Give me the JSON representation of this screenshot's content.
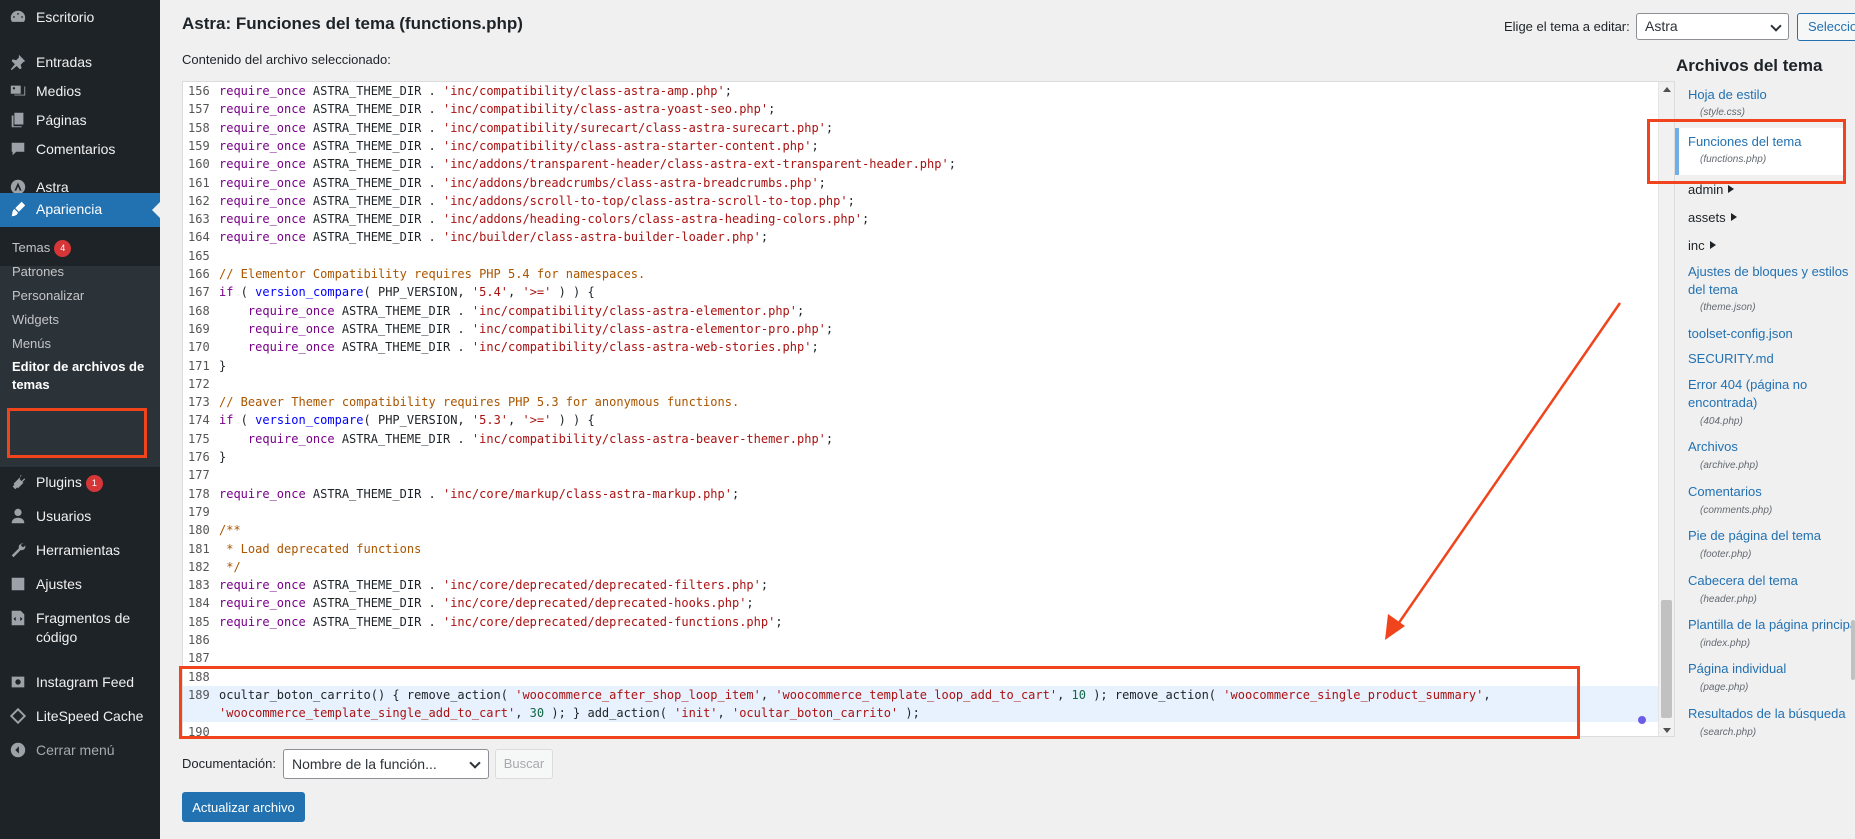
{
  "sidebar": {
    "items": [
      {
        "label": "Escritorio",
        "icon": "dashboard-icon"
      },
      {
        "label": "Entradas",
        "icon": "pin-icon"
      },
      {
        "label": "Medios",
        "icon": "media-icon"
      },
      {
        "label": "Páginas",
        "icon": "pages-icon"
      },
      {
        "label": "Comentarios",
        "icon": "comment-icon"
      },
      {
        "label": "Astra",
        "icon": "astra-icon"
      },
      {
        "label": "Apariencia",
        "icon": "brush-icon"
      },
      {
        "label": "Plugins",
        "icon": "plugin-icon",
        "badge": "1"
      },
      {
        "label": "Usuarios",
        "icon": "user-icon"
      },
      {
        "label": "Herramientas",
        "icon": "wrench-icon"
      },
      {
        "label": "Ajustes",
        "icon": "settings-icon"
      },
      {
        "label": "Fragmentos de código",
        "icon": "code-icon"
      },
      {
        "label": "Instagram Feed",
        "icon": "instagram-icon"
      },
      {
        "label": "LiteSpeed Cache",
        "icon": "diamond-icon"
      },
      {
        "label": "Cerrar menú",
        "icon": "collapse-icon"
      }
    ],
    "submenu": [
      {
        "label": "Temas",
        "badge": "4"
      },
      {
        "label": "Patrones"
      },
      {
        "label": "Personalizar"
      },
      {
        "label": "Widgets"
      },
      {
        "label": "Menús"
      },
      {
        "label": "Editor de archivos de temas"
      }
    ]
  },
  "header": {
    "title": "Astra: Funciones del tema (functions.php)",
    "theme_select_label": "Elige el tema a editar:",
    "theme_select_value": "Astra",
    "select_button": "Seleccionar",
    "content_label": "Contenido del archivo seleccionado:"
  },
  "editor": {
    "lines": [
      {
        "n": "156",
        "code": [
          [
            "kw",
            "require_once"
          ],
          [
            "vr",
            " ASTRA_THEME_DIR . "
          ],
          [
            "str",
            "'inc/compatibility/class-astra-amp.php'"
          ],
          [
            "vr",
            ";"
          ]
        ]
      },
      {
        "n": "157",
        "code": [
          [
            "kw",
            "require_once"
          ],
          [
            "vr",
            " ASTRA_THEME_DIR . "
          ],
          [
            "str",
            "'inc/compatibility/class-astra-yoast-seo.php'"
          ],
          [
            "vr",
            ";"
          ]
        ]
      },
      {
        "n": "158",
        "code": [
          [
            "kw",
            "require_once"
          ],
          [
            "vr",
            " ASTRA_THEME_DIR . "
          ],
          [
            "str",
            "'inc/compatibility/surecart/class-astra-surecart.php'"
          ],
          [
            "vr",
            ";"
          ]
        ]
      },
      {
        "n": "159",
        "code": [
          [
            "kw",
            "require_once"
          ],
          [
            "vr",
            " ASTRA_THEME_DIR . "
          ],
          [
            "str",
            "'inc/compatibility/class-astra-starter-content.php'"
          ],
          [
            "vr",
            ";"
          ]
        ]
      },
      {
        "n": "160",
        "code": [
          [
            "kw",
            "require_once"
          ],
          [
            "vr",
            " ASTRA_THEME_DIR . "
          ],
          [
            "str",
            "'inc/addons/transparent-header/class-astra-ext-transparent-header.php'"
          ],
          [
            "vr",
            ";"
          ]
        ]
      },
      {
        "n": "161",
        "code": [
          [
            "kw",
            "require_once"
          ],
          [
            "vr",
            " ASTRA_THEME_DIR . "
          ],
          [
            "str",
            "'inc/addons/breadcrumbs/class-astra-breadcrumbs.php'"
          ],
          [
            "vr",
            ";"
          ]
        ]
      },
      {
        "n": "162",
        "code": [
          [
            "kw",
            "require_once"
          ],
          [
            "vr",
            " ASTRA_THEME_DIR . "
          ],
          [
            "str",
            "'inc/addons/scroll-to-top/class-astra-scroll-to-top.php'"
          ],
          [
            "vr",
            ";"
          ]
        ]
      },
      {
        "n": "163",
        "code": [
          [
            "kw",
            "require_once"
          ],
          [
            "vr",
            " ASTRA_THEME_DIR . "
          ],
          [
            "str",
            "'inc/addons/heading-colors/class-astra-heading-colors.php'"
          ],
          [
            "vr",
            ";"
          ]
        ]
      },
      {
        "n": "164",
        "code": [
          [
            "kw",
            "require_once"
          ],
          [
            "vr",
            " ASTRA_THEME_DIR . "
          ],
          [
            "str",
            "'inc/builder/class-astra-builder-loader.php'"
          ],
          [
            "vr",
            ";"
          ]
        ]
      },
      {
        "n": "165",
        "code": []
      },
      {
        "n": "166",
        "code": [
          [
            "cm",
            "// Elementor Compatibility requires PHP 5.4 for namespaces."
          ]
        ]
      },
      {
        "n": "167",
        "code": [
          [
            "kw",
            "if"
          ],
          [
            "vr",
            " ( "
          ],
          [
            "df",
            "version_compare"
          ],
          [
            "vr",
            "( PHP_VERSION, "
          ],
          [
            "str",
            "'5.4'"
          ],
          [
            "vr",
            ", "
          ],
          [
            "str",
            "'>='"
          ],
          [
            "vr",
            " ) ) {"
          ]
        ]
      },
      {
        "n": "168",
        "code": [
          [
            "vr",
            "    "
          ],
          [
            "kw",
            "require_once"
          ],
          [
            "vr",
            " ASTRA_THEME_DIR . "
          ],
          [
            "str",
            "'inc/compatibility/class-astra-elementor.php'"
          ],
          [
            "vr",
            ";"
          ]
        ]
      },
      {
        "n": "169",
        "code": [
          [
            "vr",
            "    "
          ],
          [
            "kw",
            "require_once"
          ],
          [
            "vr",
            " ASTRA_THEME_DIR . "
          ],
          [
            "str",
            "'inc/compatibility/class-astra-elementor-pro.php'"
          ],
          [
            "vr",
            ";"
          ]
        ]
      },
      {
        "n": "170",
        "code": [
          [
            "vr",
            "    "
          ],
          [
            "kw",
            "require_once"
          ],
          [
            "vr",
            " ASTRA_THEME_DIR . "
          ],
          [
            "str",
            "'inc/compatibility/class-astra-web-stories.php'"
          ],
          [
            "vr",
            ";"
          ]
        ]
      },
      {
        "n": "171",
        "code": [
          [
            "vr",
            "}"
          ]
        ]
      },
      {
        "n": "172",
        "code": []
      },
      {
        "n": "173",
        "code": [
          [
            "cm",
            "// Beaver Themer compatibility requires PHP 5.3 for anonymous functions."
          ]
        ]
      },
      {
        "n": "174",
        "code": [
          [
            "kw",
            "if"
          ],
          [
            "vr",
            " ( "
          ],
          [
            "df",
            "version_compare"
          ],
          [
            "vr",
            "( PHP_VERSION, "
          ],
          [
            "str",
            "'5.3'"
          ],
          [
            "vr",
            ", "
          ],
          [
            "str",
            "'>='"
          ],
          [
            "vr",
            " ) ) {"
          ]
        ]
      },
      {
        "n": "175",
        "code": [
          [
            "vr",
            "    "
          ],
          [
            "kw",
            "require_once"
          ],
          [
            "vr",
            " ASTRA_THEME_DIR . "
          ],
          [
            "str",
            "'inc/compatibility/class-astra-beaver-themer.php'"
          ],
          [
            "vr",
            ";"
          ]
        ]
      },
      {
        "n": "176",
        "code": [
          [
            "vr",
            "}"
          ]
        ]
      },
      {
        "n": "177",
        "code": []
      },
      {
        "n": "178",
        "code": [
          [
            "kw",
            "require_once"
          ],
          [
            "vr",
            " ASTRA_THEME_DIR . "
          ],
          [
            "str",
            "'inc/core/markup/class-astra-markup.php'"
          ],
          [
            "vr",
            ";"
          ]
        ]
      },
      {
        "n": "179",
        "code": []
      },
      {
        "n": "180",
        "code": [
          [
            "cm",
            "/**"
          ]
        ]
      },
      {
        "n": "181",
        "code": [
          [
            "cm",
            " * Load deprecated functions"
          ]
        ]
      },
      {
        "n": "182",
        "code": [
          [
            "cm",
            " */"
          ]
        ]
      },
      {
        "n": "183",
        "code": [
          [
            "kw",
            "require_once"
          ],
          [
            "vr",
            " ASTRA_THEME_DIR . "
          ],
          [
            "str",
            "'inc/core/deprecated/deprecated-filters.php'"
          ],
          [
            "vr",
            ";"
          ]
        ]
      },
      {
        "n": "184",
        "code": [
          [
            "kw",
            "require_once"
          ],
          [
            "vr",
            " ASTRA_THEME_DIR . "
          ],
          [
            "str",
            "'inc/core/deprecated/deprecated-hooks.php'"
          ],
          [
            "vr",
            ";"
          ]
        ]
      },
      {
        "n": "185",
        "code": [
          [
            "kw",
            "require_once"
          ],
          [
            "vr",
            " ASTRA_THEME_DIR . "
          ],
          [
            "str",
            "'inc/core/deprecated/deprecated-functions.php'"
          ],
          [
            "vr",
            ";"
          ]
        ]
      },
      {
        "n": "186",
        "code": []
      },
      {
        "n": "187",
        "code": []
      },
      {
        "n": "188",
        "code": []
      },
      {
        "n": "189",
        "code": [
          [
            "vr",
            "ocultar_boton_carrito() { remove_action( "
          ],
          [
            "str",
            "'woocommerce_after_shop_loop_item'"
          ],
          [
            "vr",
            ", "
          ],
          [
            "str",
            "'woocommerce_template_loop_add_to_cart'"
          ],
          [
            "vr",
            ", "
          ],
          [
            "num",
            "10"
          ],
          [
            "vr",
            " ); remove_action( "
          ],
          [
            "str",
            "'woocommerce_single_product_summary'"
          ],
          [
            "vr",
            ","
          ]
        ],
        "active": true
      },
      {
        "n": "",
        "code": [
          [
            "str",
            "'woocommerce_template_single_add_to_cart'"
          ],
          [
            "vr",
            ", "
          ],
          [
            "num",
            "30"
          ],
          [
            "vr",
            " ); } add_action( "
          ],
          [
            "str",
            "'init'"
          ],
          [
            "vr",
            ", "
          ],
          [
            "str",
            "'ocultar_boton_carrito'"
          ],
          [
            "vr",
            " );"
          ]
        ],
        "active": true
      },
      {
        "n": "190",
        "code": []
      }
    ]
  },
  "documentation": {
    "label": "Documentación:",
    "select_value": "Nombre de la función...",
    "search_button": "Buscar"
  },
  "update_button": "Actualizar archivo",
  "files_panel": {
    "title": "Archivos del tema",
    "entries": [
      {
        "type": "file",
        "label": "Hoja de estilo",
        "sub": "(style.css)"
      },
      {
        "type": "file",
        "label": "Funciones del tema",
        "sub": "(functions.php)",
        "active": true
      },
      {
        "type": "folder",
        "label": "admin"
      },
      {
        "type": "folder",
        "label": "assets"
      },
      {
        "type": "folder",
        "label": "inc"
      },
      {
        "type": "file",
        "label": "Ajustes de bloques y estilos del tema",
        "sub": "(theme.json)"
      },
      {
        "type": "file",
        "label": "toolset-config.json"
      },
      {
        "type": "file",
        "label": "SECURITY.md"
      },
      {
        "type": "file",
        "label": "Error 404 (página no encontrada)",
        "sub": "(404.php)"
      },
      {
        "type": "file",
        "label": "Archivos",
        "sub": "(archive.php)"
      },
      {
        "type": "file",
        "label": "Comentarios",
        "sub": "(comments.php)"
      },
      {
        "type": "file",
        "label": "Pie de página del tema",
        "sub": "(footer.php)"
      },
      {
        "type": "file",
        "label": "Cabecera del tema",
        "sub": "(header.php)"
      },
      {
        "type": "file",
        "label": "Plantilla de la página principal",
        "sub": "(index.php)"
      },
      {
        "type": "file",
        "label": "Página individual",
        "sub": "(page.php)"
      },
      {
        "type": "file",
        "label": "Resultados de la búsqueda",
        "sub": "(search.php)"
      }
    ]
  },
  "colors": {
    "admin_bar": "#1d2327",
    "accent": "#2271b1",
    "annotation": "#f0441c"
  }
}
